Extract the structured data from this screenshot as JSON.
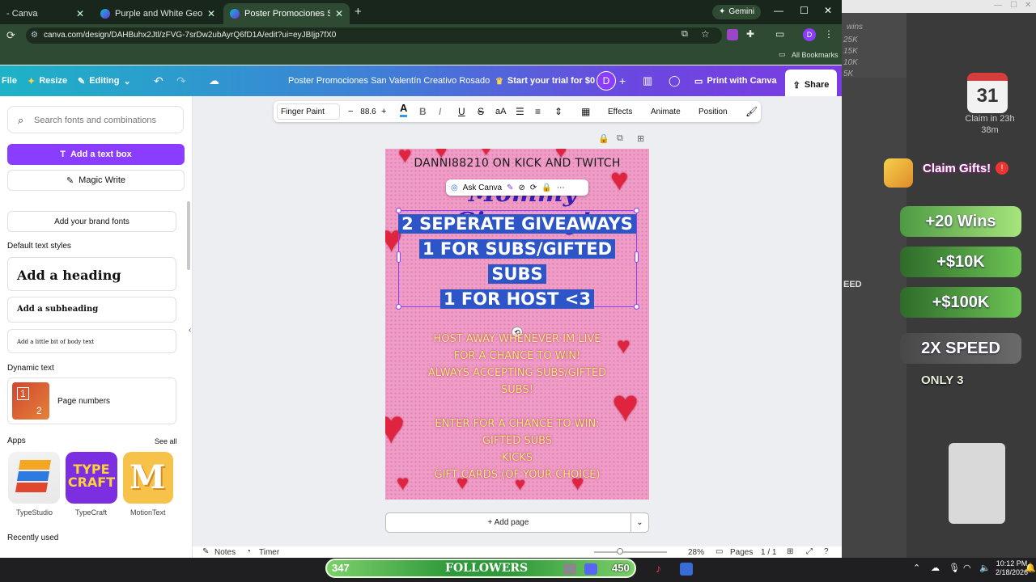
{
  "browser": {
    "tabs": [
      {
        "label": "- Canva"
      },
      {
        "label": "Purple and White Geometric Ba"
      },
      {
        "label": "Poster Promociones San Valentín"
      }
    ],
    "gemini_label": "Gemini",
    "url": "canva.com/design/DAHBuhx2Jtl/zFVG-7srDw2ubAyrQ6fD1A/edit?ui=eyJBIjp7fX0",
    "bookmarks_label": "All Bookmarks",
    "profile_initial": "D"
  },
  "header": {
    "file": "File",
    "resize": "Resize",
    "editing": "Editing",
    "title": "Poster Promociones San Valentín Creativo Rosado",
    "trial": "Start your trial for $0",
    "avatar": "D",
    "print": "Print with Canva",
    "share": "Share"
  },
  "left_panel": {
    "search_placeholder": "Search fonts and combinations",
    "add_text_box": "Add a text box",
    "magic_write": "Magic Write",
    "brand_fonts": "Add your brand fonts",
    "default_styles_title": "Default text styles",
    "heading": "Add a heading",
    "subheading": "Add a subheading",
    "body": "Add a little bit of body text",
    "dynamic_title": "Dynamic text",
    "page_numbers": "Page numbers",
    "page_thumb_nums": [
      "1",
      "2"
    ],
    "apps_title": "Apps",
    "see_all": "See all",
    "apps": [
      {
        "label": "TypeStudio"
      },
      {
        "label": "TypeCraft",
        "art": "TYPE CRAFT"
      },
      {
        "label": "MotionText",
        "art": "M"
      }
    ],
    "recently_used": "Recently used"
  },
  "toolbar": {
    "font": "Finger Paint",
    "minus": "−",
    "size": "88.6",
    "plus": "+",
    "text_color_glyph": "A",
    "bold": "B",
    "italic": "I",
    "underline": "U",
    "strike": "S",
    "case": "aA",
    "effects": "Effects",
    "animate": "Animate",
    "position": "Position"
  },
  "poster": {
    "top_line": "DANNI88210 ON KICK AND TWITCH",
    "script_title": "Mommy Giveaway!",
    "ask_canva": "Ask Canva",
    "selected_lines": [
      "2 SEPERATE GIVEAWAYS",
      "1 FOR SUBS/GIFTED",
      "SUBS",
      "1 FOR HOST <3"
    ],
    "body_lines": [
      "HOST AWAY WHENEVER IM LIVE",
      "FOR A CHANCE TO WIN!",
      "ALWAYS ACCEPTING SUBS/GIFTED",
      "SUBS!"
    ],
    "prize_lines": [
      "ENTER FOR A CHANCE TO WIN:",
      "GIFTED SUBS",
      "KICKS",
      "GIFT CARDS (OF YOUR CHOICE)"
    ]
  },
  "canvas_footer": {
    "add_page": "+ Add page",
    "notes": "Notes",
    "timer": "Timer",
    "zoom": "28%",
    "pages": "Pages",
    "page_count": "1 / 1"
  },
  "stream_overlay": {
    "wins_bg": [
      "wins",
      "25K",
      "15K",
      "10K",
      "5K"
    ],
    "calendar_day": "31",
    "claim_in": "Claim in 23h",
    "claim_min": "38m",
    "claim_gifts": "Claim Gifts!",
    "rewards": [
      "+20 Wins",
      "+$10K",
      "+$100K",
      "2X SPEED"
    ],
    "only": "ONLY 3",
    "side_text": "EED"
  },
  "taskbar": {
    "followers_count": "347",
    "followers_label": "FOLLOWERS",
    "badge_count": "450",
    "time": "10:12 PM",
    "date": "2/18/2026"
  },
  "colors": {
    "canva_purple": "#8b3dff",
    "selection_blue": "#2d55c8",
    "poster_pink": "#ef9cc6",
    "heart_red": "#e0233f",
    "glow_yellow": "#f2f26a"
  }
}
